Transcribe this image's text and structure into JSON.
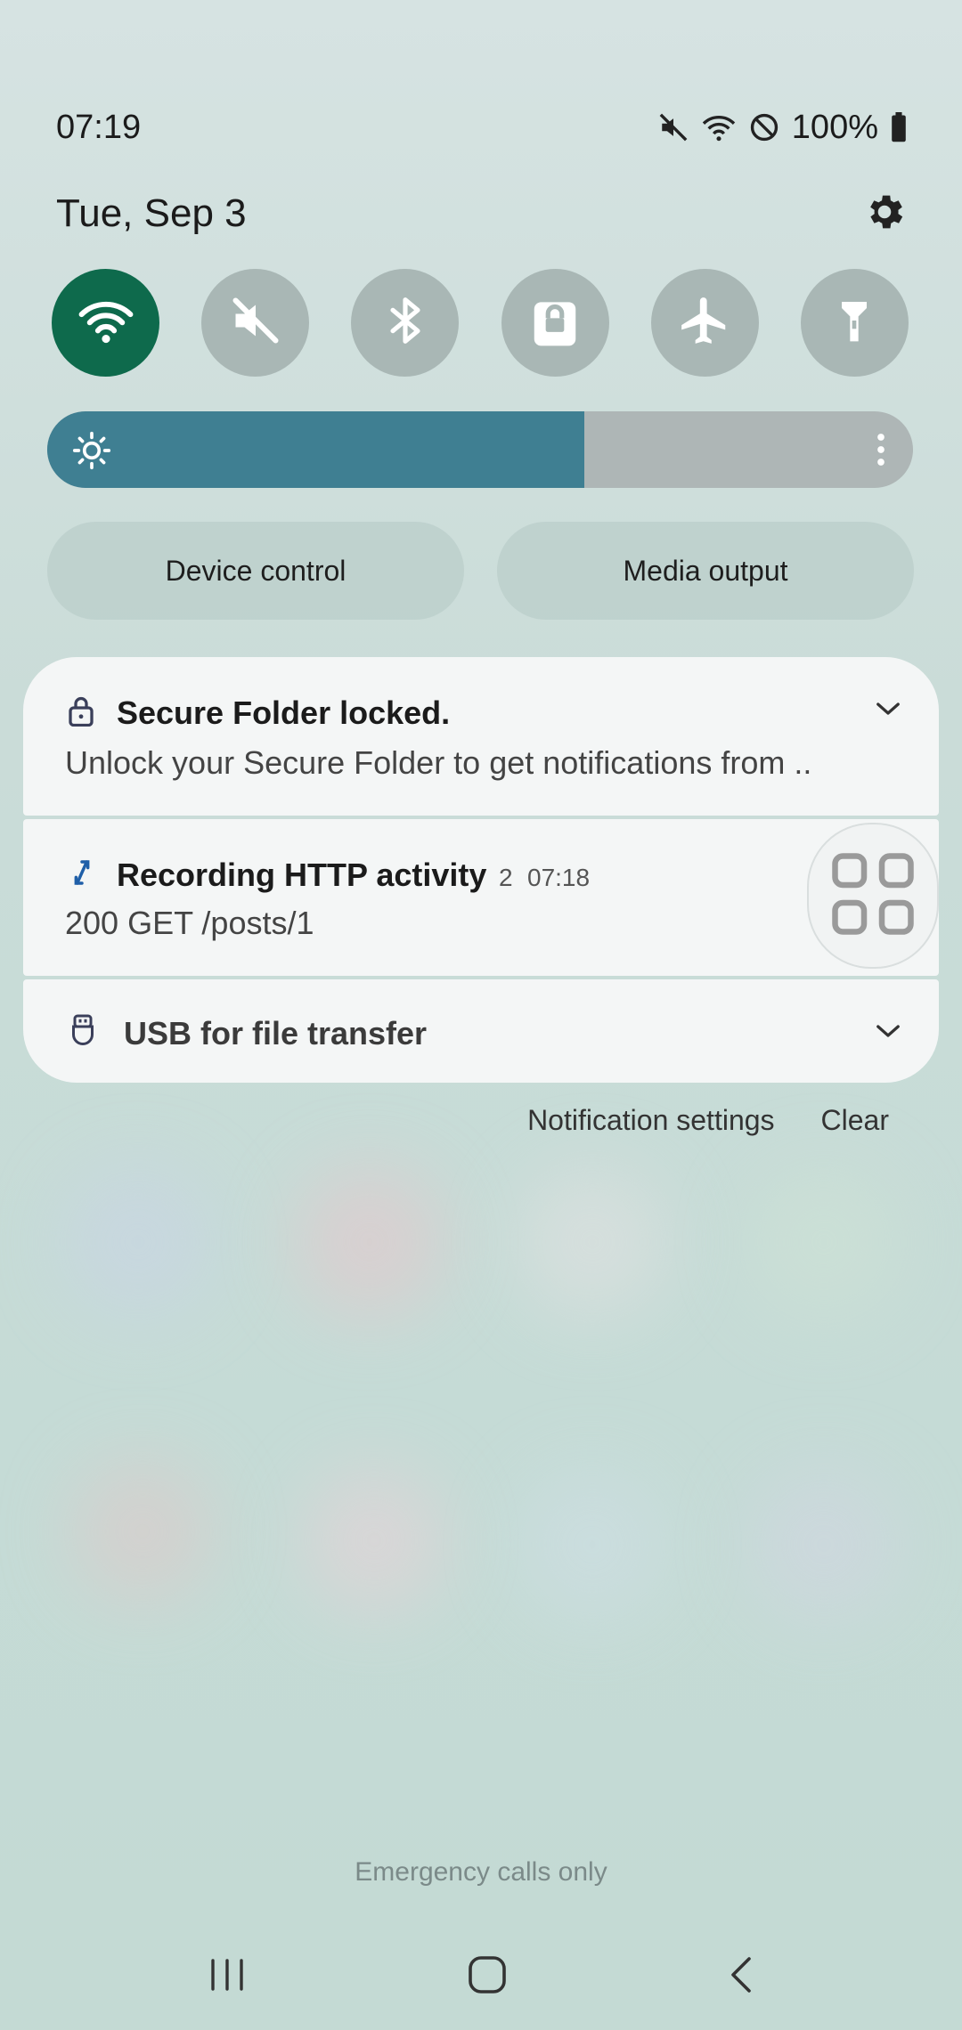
{
  "status_bar": {
    "time": "07:19",
    "battery": "100%",
    "icons": [
      "mute-icon",
      "wifi-icon",
      "do-not-disturb-icon",
      "battery-icon"
    ]
  },
  "header": {
    "date": "Tue, Sep 3",
    "settings_icon": "gear-icon"
  },
  "quick_toggles": [
    {
      "name": "wifi",
      "icon": "wifi-icon",
      "active": true
    },
    {
      "name": "sound",
      "icon": "mute-icon",
      "active": false
    },
    {
      "name": "bluetooth",
      "icon": "bluetooth-icon",
      "active": false
    },
    {
      "name": "secure-folder",
      "icon": "lock-icon",
      "active": false
    },
    {
      "name": "airplane-mode",
      "icon": "airplane-icon",
      "active": false
    },
    {
      "name": "flashlight",
      "icon": "flashlight-icon",
      "active": false
    }
  ],
  "brightness": {
    "level": 0.62
  },
  "buttons": {
    "device_control": "Device control",
    "media_output": "Media output"
  },
  "notifications": [
    {
      "title": "Secure Folder locked.",
      "body": "Unlock your Secure Folder to get notifications from .."
    },
    {
      "title": "Recording HTTP activity",
      "count": "2",
      "time": "07:18",
      "body": "200 GET /posts/1"
    },
    {
      "title": "USB for file transfer"
    }
  ],
  "notification_actions": {
    "settings": "Notification settings",
    "clear": "Clear"
  },
  "footer": {
    "emergency": "Emergency calls only"
  },
  "colors": {
    "accent_green": "#0e6a4c",
    "brightness_fill": "#3f7f92"
  }
}
